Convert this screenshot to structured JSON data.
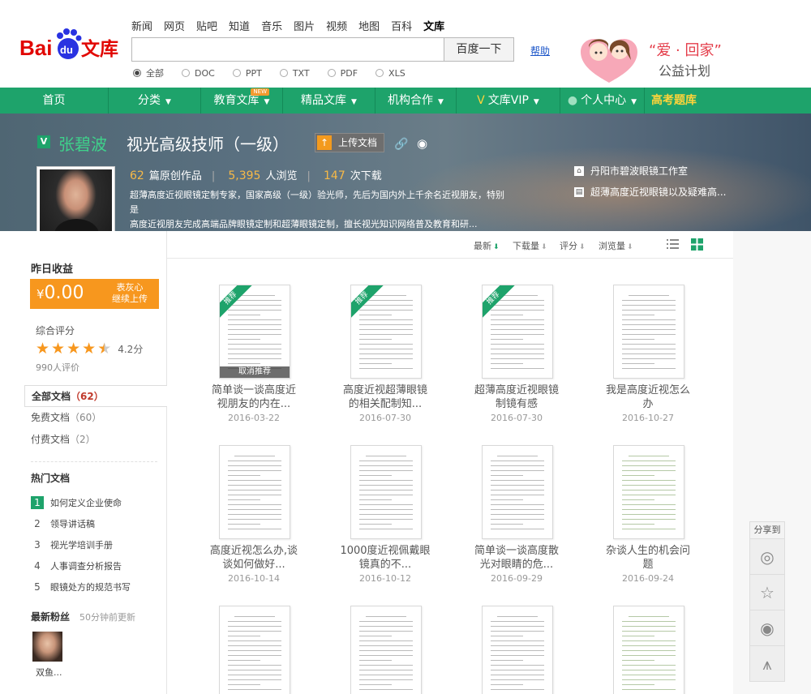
{
  "header": {
    "logo_text": "Baidu文库",
    "nav": [
      "新闻",
      "网页",
      "贴吧",
      "知道",
      "音乐",
      "图片",
      "视频",
      "地图",
      "百科",
      "文库"
    ],
    "nav_active_index": 9,
    "search": {
      "value": "",
      "placeholder": "",
      "button": "百度一下"
    },
    "help": "帮助",
    "filters": [
      "全部",
      "DOC",
      "PPT",
      "TXT",
      "PDF",
      "XLS"
    ],
    "filter_selected": "全部",
    "charity_line1": "“爱 · 回家”",
    "charity_line2": "公益计划"
  },
  "mainnav": {
    "items": [
      "首页",
      "分类",
      "教育文库",
      "精品文库",
      "机构合作",
      "文库VIP",
      "个人中心",
      "高考题库"
    ],
    "new_tag": "NEW"
  },
  "profile": {
    "badge": "V",
    "name": "张碧波",
    "title": "视光高级技师（一级）",
    "upload_button": "上传文档",
    "works_count": "62",
    "works_label": "篇原创作品",
    "views_count": "5,395",
    "views_label": "人浏览",
    "downloads_count": "147",
    "downloads_label": "次下载",
    "description_line1": "超薄高度近视眼镜定制专家，国家高级（一级）验光师，先后为国内外上千余名近视朋友，特别是",
    "description_line2": "高度近视朋友完成高端品牌眼镜定制和超薄眼镜定制，擅长视光知识网络普及教育和研...",
    "org": "丹阳市碧波眼镜工作室",
    "specialty": "超薄高度近视眼镜以及疑难高..."
  },
  "sidebar": {
    "earn_title": "昨日收益",
    "earn_amount_symbol": "¥",
    "earn_amount": "0.00",
    "earn_tip_line1": "表灰心",
    "earn_tip_line2": "继续上传",
    "rating_title": "综合评分",
    "rating_value": 4.2,
    "rating_text": "4.2分",
    "rating_count": "990人评价",
    "tabs": [
      {
        "label": "全部文档",
        "count": "（62）"
      },
      {
        "label": "免费文档",
        "count": "（60）"
      },
      {
        "label": "付费文档",
        "count": "（2）"
      }
    ],
    "hot_title": "热门文档",
    "hot_docs": [
      "如何定义企业使命",
      "领导讲话稿",
      "视光学培训手册",
      "人事调查分析报告",
      "眼镜处方的规范书写"
    ],
    "fans_title": "最新粉丝",
    "fans_subtitle": "50分钟前更新",
    "fan_name": "双鱼..."
  },
  "toolbar": {
    "sorts": [
      "最新",
      "下载量",
      "评分",
      "浏览量"
    ],
    "active_sort": "最新"
  },
  "docs": [
    {
      "title1": "简单谈一谈高度近",
      "title2": "视朋友的内在...",
      "date": "2016-03-22",
      "recommended": true,
      "cancel_label": "取消推荐"
    },
    {
      "title1": "高度近视超薄眼镜",
      "title2": "的相关配制知...",
      "date": "2016-07-30",
      "recommended": true
    },
    {
      "title1": "超薄高度近视眼镜",
      "title2": "制镜有感",
      "date": "2016-07-30",
      "recommended": true
    },
    {
      "title1": "我是高度近视怎么",
      "title2": "办",
      "date": "2016-10-27",
      "recommended": false
    },
    {
      "title1": "高度近视怎么办,谈",
      "title2": "谈如何做好...",
      "date": "2016-10-14",
      "recommended": false
    },
    {
      "title1": "1000度近视佩戴眼",
      "title2": "镜真的不...",
      "date": "2016-10-12",
      "recommended": false
    },
    {
      "title1": "简单谈一谈高度散",
      "title2": "光对眼睛的危...",
      "date": "2016-09-29",
      "recommended": false
    },
    {
      "title1": "杂谈人生的机会问",
      "title2": "题",
      "date": "2016-09-24",
      "recommended": false
    },
    {
      "title1": "",
      "title2": "",
      "date": "",
      "recommended": false
    },
    {
      "title1": "",
      "title2": "",
      "date": "",
      "recommended": false
    },
    {
      "title1": "",
      "title2": "",
      "date": "",
      "recommended": false
    },
    {
      "title1": "",
      "title2": "",
      "date": "",
      "recommended": false
    }
  ],
  "recommend_label": "推荐",
  "share": {
    "label": "分享到",
    "targets": [
      "wechat-icon",
      "qzone-icon",
      "weibo-icon",
      "tieba-icon"
    ]
  },
  "colors": {
    "brand_green": "#1ea36b",
    "orange": "#f7971e",
    "baidu_red": "#e10601",
    "baidu_blue": "#2932e1"
  }
}
